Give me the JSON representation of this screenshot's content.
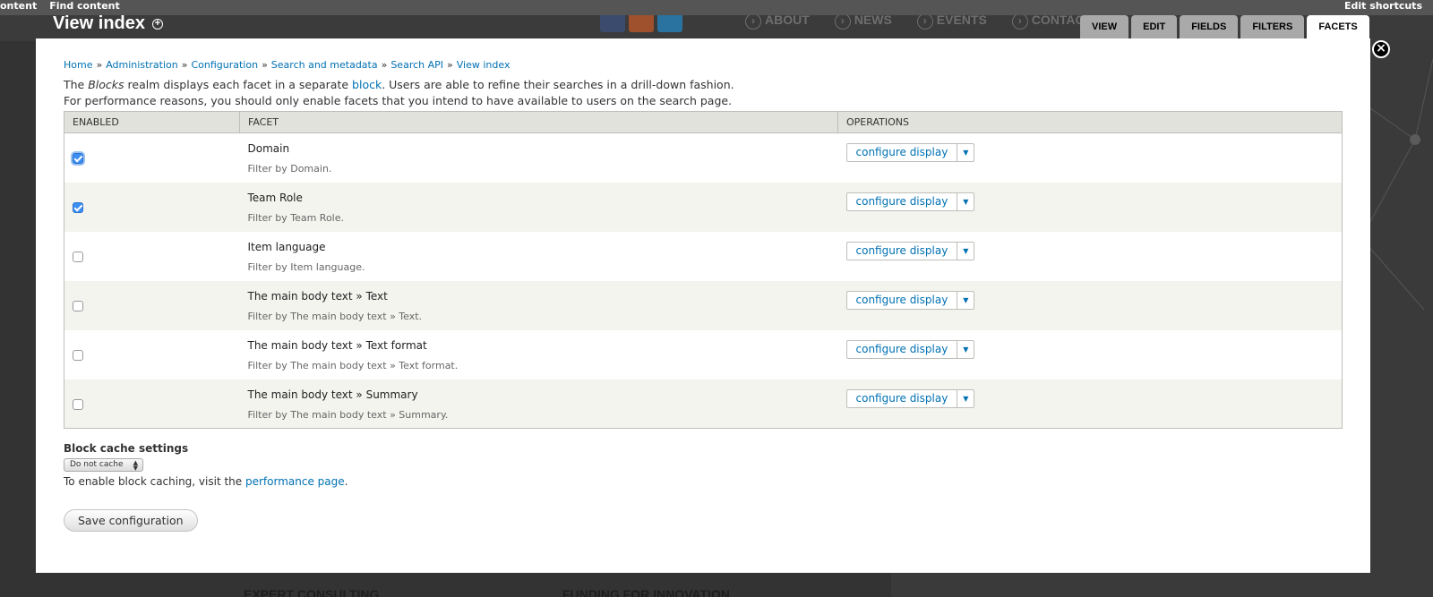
{
  "toolbar": {
    "left_items": [
      "ontent",
      "Find content"
    ],
    "edit_shortcuts": "Edit shortcuts"
  },
  "overlay": {
    "title": "View index"
  },
  "background": {
    "nav": [
      "ABOUT",
      "NEWS",
      "EVENTS",
      "CONTAC"
    ],
    "bottom_left": "EXPERT CONSULTING",
    "bottom_right": "FUNDING FOR INNOVATION",
    "social_colors": [
      "#3b5998",
      "#f26522",
      "#1da1f2"
    ]
  },
  "tabs": [
    {
      "label": "VIEW",
      "active": false
    },
    {
      "label": "EDIT",
      "active": false
    },
    {
      "label": "FIELDS",
      "active": false
    },
    {
      "label": "FILTERS",
      "active": false
    },
    {
      "label": "FACETS",
      "active": true
    }
  ],
  "close_label": "×",
  "breadcrumb": [
    "Home",
    "Administration",
    "Configuration",
    "Search and metadata",
    "Search API",
    "View index"
  ],
  "breadcrumb_separator": "»",
  "description": {
    "line1_prefix": "The ",
    "line1_em": "Blocks",
    "line1_mid": " realm displays each facet in a separate ",
    "line1_link": "block",
    "line1_suffix": ". Users are able to refine their searches in a drill-down fashion.",
    "line2": "For performance reasons, you should only enable facets that you intend to have available to users on the search page."
  },
  "table": {
    "headers": [
      "ENABLED",
      "FACET",
      "OPERATIONS"
    ],
    "rows": [
      {
        "name": "Domain",
        "description": "Filter by Domain.",
        "enabled": true,
        "operation": "configure display"
      },
      {
        "name": "Team Role",
        "description": "Filter by Team Role.",
        "enabled": true,
        "operation": "configure display"
      },
      {
        "name": "Item language",
        "description": "Filter by Item language.",
        "enabled": false,
        "operation": "configure display"
      },
      {
        "name": "The main body text » Text",
        "description": "Filter by The main body text » Text.",
        "enabled": false,
        "operation": "configure display"
      },
      {
        "name": "The main body text » Text format",
        "description": "Filter by The main body text » Text format.",
        "enabled": false,
        "operation": "configure display"
      },
      {
        "name": "The main body text » Summary",
        "description": "Filter by The main body text » Summary.",
        "enabled": false,
        "operation": "configure display"
      }
    ]
  },
  "cache": {
    "label": "Block cache settings",
    "selected": "Do not cache",
    "help_prefix": "To enable block caching, visit the ",
    "help_link": "performance page",
    "help_suffix": "."
  },
  "save_label": "Save configuration",
  "colors": {
    "link": "#0071b3",
    "checkbox_checked": "#3b8ff3",
    "header_bg": "#e1e2dc",
    "row_alt": "#f3f4ee"
  }
}
